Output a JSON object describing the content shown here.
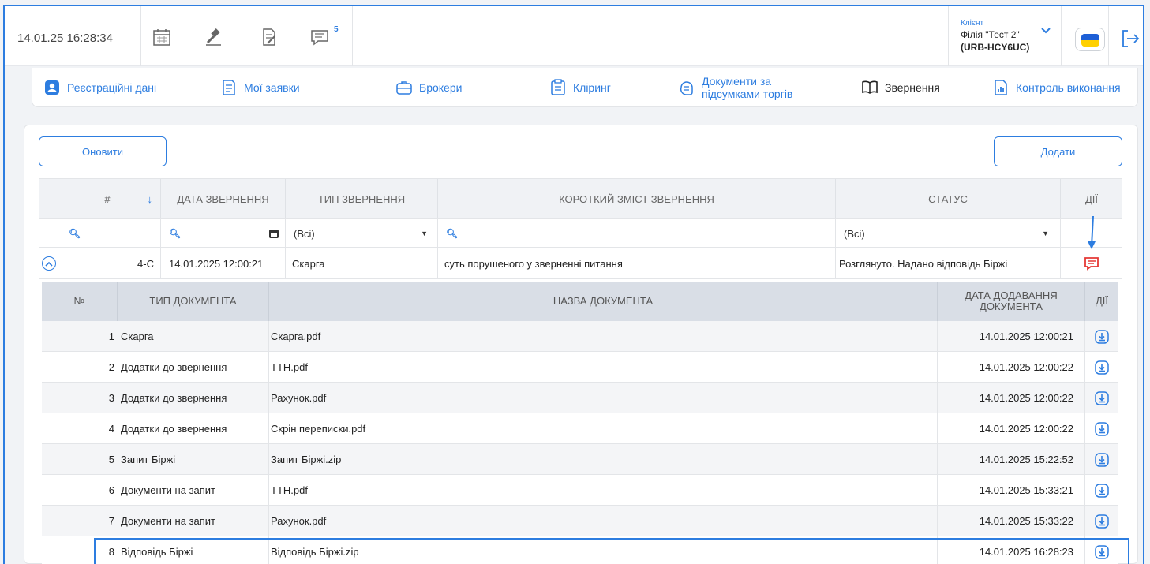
{
  "header": {
    "datetime": "14.01.25 16:28:34",
    "messages_badge": "5",
    "client_label": "Клієнт",
    "client_name": "Філія \"Тест 2\"",
    "client_code": "(URB-HCY6UC)",
    "icons": [
      "calendar-icon",
      "gavel-icon",
      "document-edit-icon",
      "messages-icon",
      "flag-icon",
      "logout-icon"
    ]
  },
  "nav": {
    "items": [
      {
        "label": "Реєстраційні дані",
        "icon": "user-card-icon"
      },
      {
        "label": "Мої заявки",
        "icon": "list-icon"
      },
      {
        "label": "Брокери",
        "icon": "briefcase-icon"
      },
      {
        "label": "Кліринг",
        "icon": "clipboard-icon"
      },
      {
        "label": "Документи за",
        "label2": "підсумками торгів",
        "icon": "document-icon"
      },
      {
        "label": "Звернення",
        "icon": "book-icon"
      },
      {
        "label": "Контроль виконання",
        "icon": "chart-icon"
      }
    ]
  },
  "toolbar": {
    "refresh_label": "Оновити",
    "add_label": "Додати"
  },
  "grid": {
    "columns": [
      "#",
      "ДАТА ЗВЕРНЕННЯ",
      "ТИП ЗВЕРНЕННЯ",
      "КОРОТКИЙ ЗМІСТ ЗВЕРНЕННЯ",
      "СТАТУС",
      "ДІЇ"
    ],
    "filters": {
      "type_value": "(Всі)",
      "status_value": "(Всі)"
    },
    "row": {
      "number": "4-С",
      "date": "14.01.2025 12:00:21",
      "type": "Скарга",
      "summary": "суть порушеного у зверненні питання",
      "status": "Розглянуто. Надано відповідь Біржі"
    }
  },
  "subgrid": {
    "columns": [
      "№",
      "ТИП ДОКУМЕНТА",
      "НАЗВА ДОКУМЕНТА",
      "ДАТА ДОДАВАННЯ ДОКУМЕНТА",
      "ДІЇ"
    ],
    "rows": [
      {
        "n": "1",
        "type": "Скарга",
        "name": "Скарга.pdf",
        "date": "14.01.2025 12:00:21"
      },
      {
        "n": "2",
        "type": "Додатки до звернення",
        "name": "ТТН.pdf",
        "date": "14.01.2025 12:00:22"
      },
      {
        "n": "3",
        "type": "Додатки до звернення",
        "name": "Рахунок.pdf",
        "date": "14.01.2025 12:00:22"
      },
      {
        "n": "4",
        "type": "Додатки до звернення",
        "name": "Скрін переписки.pdf",
        "date": "14.01.2025 12:00:22"
      },
      {
        "n": "5",
        "type": "Запит Біржі",
        "name": "Запит Біржі.zip",
        "date": "14.01.2025 15:22:52"
      },
      {
        "n": "6",
        "type": "Документи на запит",
        "name": "ТТН.pdf",
        "date": "14.01.2025 15:33:21"
      },
      {
        "n": "7",
        "type": "Документи на запит",
        "name": "Рахунок.pdf",
        "date": "14.01.2025 15:33:22"
      },
      {
        "n": "8",
        "type": "Відповідь Біржі",
        "name": "Відповідь Біржі.zip",
        "date": "14.01.2025 16:28:23"
      }
    ]
  },
  "colors": {
    "accent": "#2d7de0",
    "action_red": "#e53935"
  }
}
